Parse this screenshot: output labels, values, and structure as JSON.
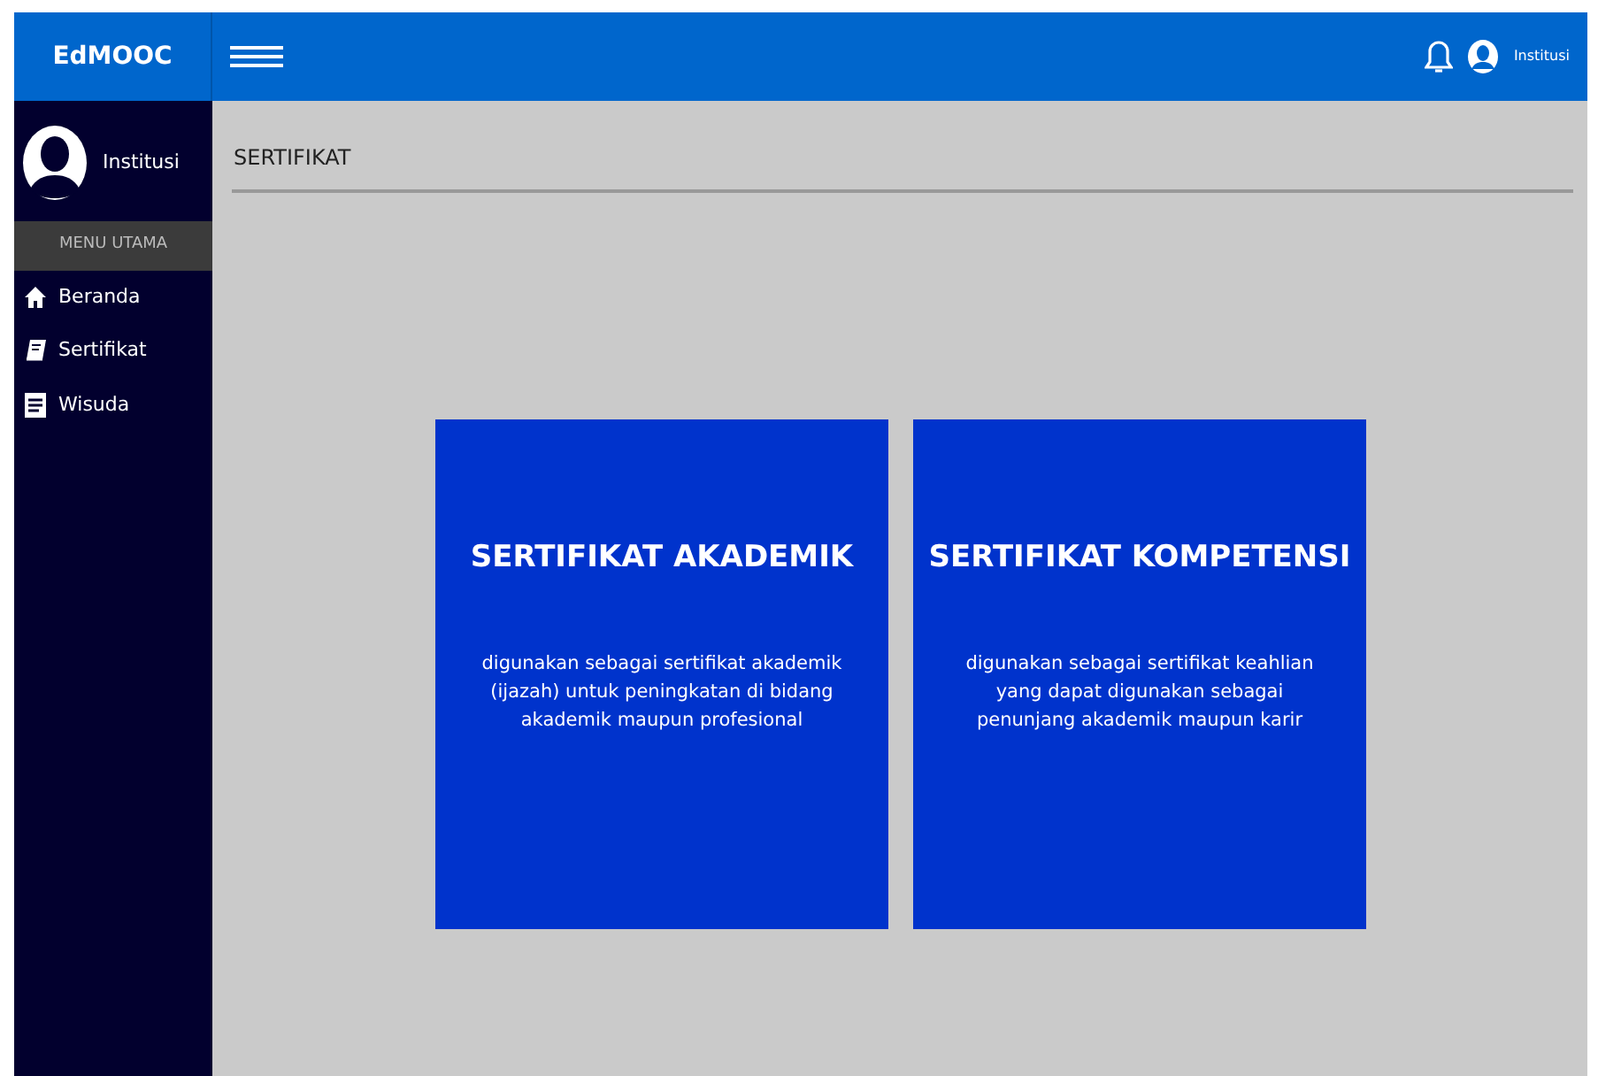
{
  "brand": "EdMOOC",
  "topbar": {
    "user": "Institusi"
  },
  "sidebar": {
    "user": "Institusi",
    "section": "MENU UTAMA",
    "items": [
      {
        "label": "Beranda",
        "kind": "home"
      },
      {
        "label": "Sertifikat",
        "kind": "book"
      },
      {
        "label": "Wisuda",
        "kind": "doc"
      }
    ]
  },
  "page_title": "SERTIFIKAT",
  "cards": [
    {
      "title": "SERTIFIKAT AKADEMIK",
      "description": "digunakan sebagai sertifikat akademik\n(ijazah) untuk peningkatan di bidang\nakademik maupun profesional"
    },
    {
      "title": "SERTIFIKAT KOMPETENSI",
      "description": "digunakan sebagai sertifikat keahlian\nyang dapat digunakan sebagai\npenunjang akademik maupun karir"
    }
  ]
}
